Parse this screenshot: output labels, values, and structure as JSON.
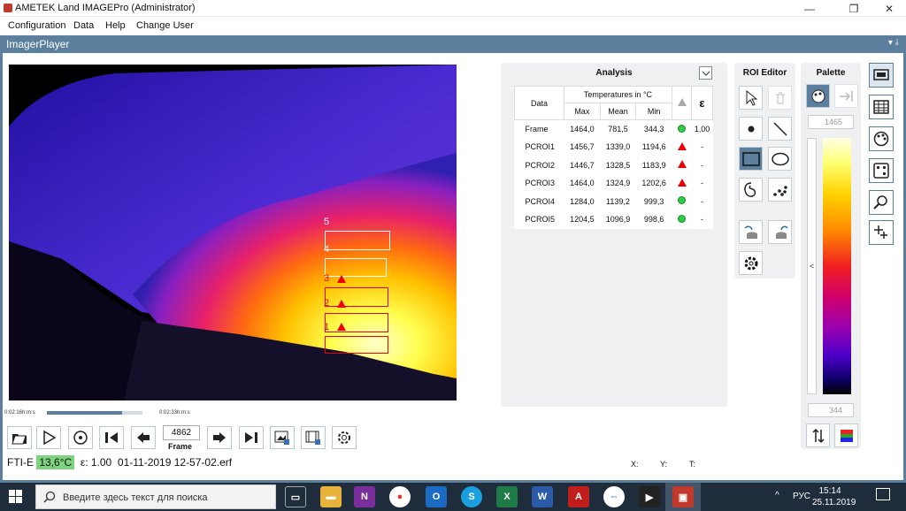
{
  "window": {
    "title": "AMETEK Land IMAGEPro (Administrator)",
    "minimize": "—",
    "maximize": "❐",
    "close": "✕"
  },
  "menu": [
    "Configuration",
    "Data",
    "Help",
    "Change User"
  ],
  "panel": {
    "title": "ImagerPlayer",
    "pin": "▾ ⫰"
  },
  "player": {
    "time_start": "0:02:16h:m:s",
    "time_end": "0:02:33h:m:s",
    "progress": 0.79,
    "frame_value": "4862",
    "frame_label": "Frame",
    "roi_labels": [
      "5",
      "4",
      "3",
      "2",
      "1"
    ]
  },
  "status": {
    "sensor": "FTI-E",
    "temp": "13,6°C",
    "emissivity": "ε: 1.00",
    "file": "01-11-2019 12-57-02.erf",
    "x": "X:",
    "y": "Y:",
    "t": "T:"
  },
  "analysis": {
    "title": "Analysis",
    "col_data": "Data",
    "col_temps": "Temperatures in °C",
    "col_max": "Max",
    "col_mean": "Mean",
    "col_min": "Min",
    "col_eps": "ε",
    "rows": [
      {
        "name": "Frame",
        "max": "1464,0",
        "mean": "781,5",
        "min": "344,3",
        "alarm": "ok",
        "eps": "1,00"
      },
      {
        "name": "PCROI1",
        "max": "1456,7",
        "mean": "1339,0",
        "min": "1194,6",
        "alarm": "alert",
        "eps": "-"
      },
      {
        "name": "PCROI2",
        "max": "1446,7",
        "mean": "1328,5",
        "min": "1183,9",
        "alarm": "alert",
        "eps": "-"
      },
      {
        "name": "PCROI3",
        "max": "1464,0",
        "mean": "1324,9",
        "min": "1202,6",
        "alarm": "alert",
        "eps": "-"
      },
      {
        "name": "PCROI4",
        "max": "1284,0",
        "mean": "1139,2",
        "min": "999,3",
        "alarm": "ok",
        "eps": "-"
      },
      {
        "name": "PCROI5",
        "max": "1204,5",
        "mean": "1096,9",
        "min": "998,6",
        "alarm": "ok",
        "eps": "-"
      }
    ]
  },
  "roi_editor": {
    "title": "ROI Editor"
  },
  "palette": {
    "title": "Palette",
    "max_value": "1465",
    "min_value": "344",
    "collapse": "<"
  },
  "taskbar": {
    "search_placeholder": "Введите здесь текст для поиска",
    "lang": "РУС",
    "time": "15:14",
    "date": "25.11.2019"
  },
  "colors": {
    "accent": "#5b7f9d",
    "ok": "#2ecc40",
    "alert": "#e00000"
  }
}
